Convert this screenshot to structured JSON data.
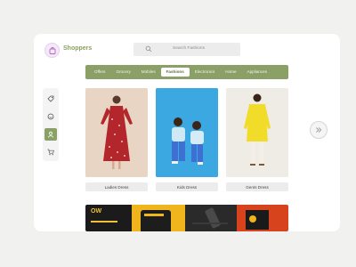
{
  "brand": {
    "name": "Shoppers"
  },
  "search": {
    "placeholder": "Search Fashions"
  },
  "nav": {
    "tabs": [
      "Offers",
      "Grocery",
      "Mobiles",
      "Fashions",
      "Electronics",
      "Home",
      "Appliances"
    ],
    "active": "Fashions"
  },
  "sidebar": {
    "items": [
      {
        "icon": "tag-icon",
        "active": false
      },
      {
        "icon": "smile-icon",
        "active": false
      },
      {
        "icon": "user-icon",
        "active": true
      },
      {
        "icon": "cart-icon",
        "active": false
      }
    ]
  },
  "products": [
    {
      "label": "Ladies Dress"
    },
    {
      "label": "Kids Dress"
    },
    {
      "label": "Gents Dress"
    }
  ],
  "banner": {
    "text": "OW"
  },
  "colors": {
    "accent": "#8aa067",
    "brand_text": "#8aa25c",
    "background": "#f1f1ef"
  }
}
